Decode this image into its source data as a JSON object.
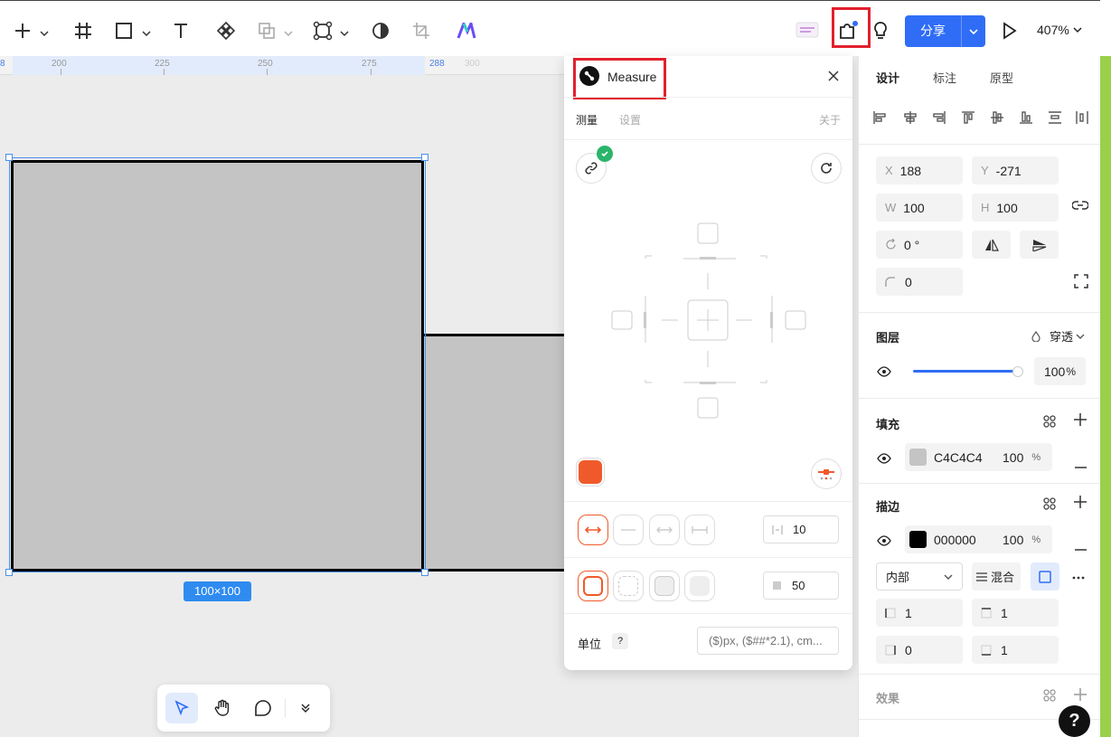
{
  "toolbar": {
    "share_label": "分享",
    "zoom": "407%"
  },
  "ruler": {
    "ticks": [
      "8",
      "200",
      "225",
      "250",
      "275",
      "288",
      "300"
    ]
  },
  "canvas": {
    "size_badge": "100×100"
  },
  "plugin": {
    "title": "Measure",
    "tabs": [
      "测量",
      "设置"
    ],
    "about": "关于",
    "spacing_value": "10",
    "radius_value": "50",
    "unit_label": "单位",
    "unit_help": "?",
    "unit_placeholder": "($)px, ($##*2.1), cm..."
  },
  "rpanel": {
    "tabs": [
      "设计",
      "标注",
      "原型"
    ],
    "x_key": "X",
    "x": "188",
    "y_key": "Y",
    "y": "-271",
    "w_key": "W",
    "w": "100",
    "h_key": "H",
    "h": "100",
    "rotation": "0 °",
    "corner": "0",
    "layer_title": "图层",
    "blend_mode": "穿透",
    "opacity": "100",
    "opacity_unit": "%",
    "fill_title": "填充",
    "fill_hex": "C4C4C4",
    "fill_opacity": "100",
    "fill_unit": "%",
    "fill_color": "#c4c4c4",
    "stroke_title": "描边",
    "stroke_hex": "000000",
    "stroke_opacity": "100",
    "stroke_unit": "%",
    "stroke_color": "#000000",
    "stroke_position": "内部",
    "stroke_mix": "混合",
    "stroke_left": "1",
    "stroke_top": "1",
    "stroke_right": "0",
    "stroke_bottom": "1",
    "effects_title": "效果",
    "help": "?"
  },
  "colors": {
    "accent": "#2f6df6",
    "highlight": "#e2202d",
    "measure_orange": "#f05a2b"
  }
}
